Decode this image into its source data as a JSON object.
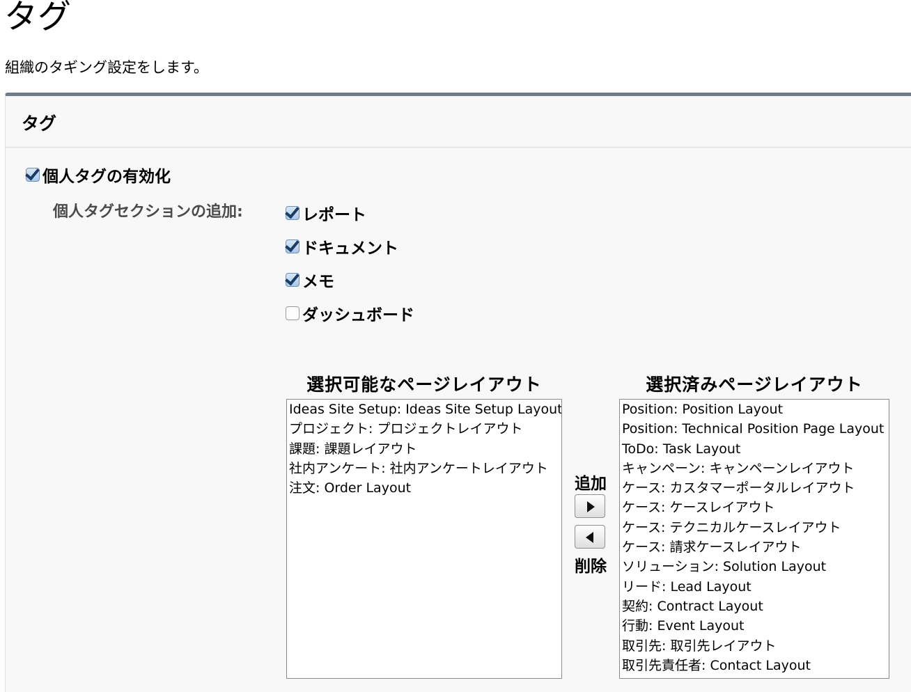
{
  "page": {
    "title": "タグ",
    "description": "組織のタギング設定をします。"
  },
  "panel": {
    "title": "タグ",
    "enable_personal_tags": {
      "label": "個人タグの有効化",
      "checked": true
    },
    "add_sections_label": "個人タグセクションの追加:",
    "sections": [
      {
        "label": "レポート",
        "checked": true
      },
      {
        "label": "ドキュメント",
        "checked": true
      },
      {
        "label": "メモ",
        "checked": true
      },
      {
        "label": "ダッシュボード",
        "checked": false
      }
    ],
    "available": {
      "title": "選択可能なページレイアウト",
      "items": [
        "Ideas Site Setup: Ideas Site Setup Layout",
        "プロジェクト: プロジェクトレイアウト",
        "課題: 課題レイアウト",
        "社内アンケート: 社内アンケートレイアウト",
        "注文: Order Layout"
      ]
    },
    "selected": {
      "title": "選択済みページレイアウト",
      "items": [
        "Position: Position Layout",
        "Position: Technical Position Page Layout",
        "ToDo: Task Layout",
        "キャンペーン: キャンペーンレイアウト",
        "ケース: カスタマーポータルレイアウト",
        "ケース: ケースレイアウト",
        "ケース: テクニカルケースレイアウト",
        "ケース: 請求ケースレイアウト",
        "ソリューション: Solution Layout",
        "リード: Lead Layout",
        "契約: Contract Layout",
        "行動: Event Layout",
        "取引先: 取引先レイアウト",
        "取引先責任者: Contact Layout"
      ]
    },
    "add_label": "追加",
    "remove_label": "削除",
    "add_icon": "arrow-right-icon",
    "remove_icon": "arrow-left-icon"
  }
}
